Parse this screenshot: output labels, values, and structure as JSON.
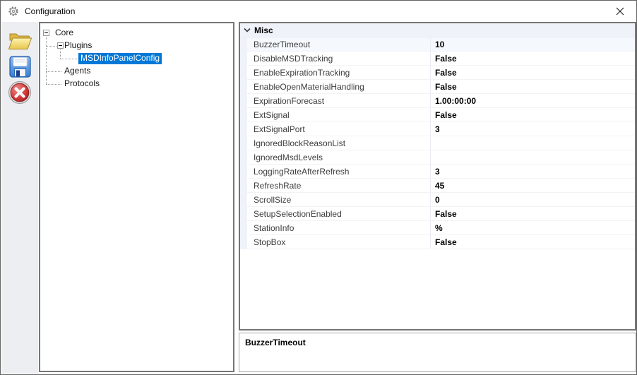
{
  "window": {
    "title": "Configuration"
  },
  "titlebar": {
    "close_glyph": "✕"
  },
  "toolbar": {
    "buttons": [
      {
        "name": "open",
        "icon": "open-folder-icon"
      },
      {
        "name": "save",
        "icon": "save-floppy-icon"
      },
      {
        "name": "cancel",
        "icon": "cancel-red-x-icon"
      }
    ]
  },
  "tree": {
    "nodes": [
      {
        "label": "Core",
        "level": 0,
        "has_children": true,
        "expanded": true
      },
      {
        "label": "Plugins",
        "level": 1,
        "has_children": true,
        "expanded": true
      },
      {
        "label": "MSDInfoPanelConfig",
        "level": 2,
        "selected": true
      },
      {
        "label": "Agents",
        "level": 1
      },
      {
        "label": "Protocols",
        "level": 1
      }
    ]
  },
  "property_grid": {
    "category": {
      "label": "Misc",
      "expanded": true
    },
    "rows": [
      {
        "name": "BuzzerTimeout",
        "value": "10",
        "selected": true
      },
      {
        "name": "DisableMSDTracking",
        "value": "False"
      },
      {
        "name": "EnableExpirationTracking",
        "value": "False"
      },
      {
        "name": "EnableOpenMaterialHandling",
        "value": "False"
      },
      {
        "name": "ExpirationForecast",
        "value": "1.00:00:00"
      },
      {
        "name": "ExtSignal",
        "value": "False"
      },
      {
        "name": "ExtSignalPort",
        "value": "3"
      },
      {
        "name": "IgnoredBlockReasonList",
        "value": ""
      },
      {
        "name": "IgnoredMsdLevels",
        "value": ""
      },
      {
        "name": "LoggingRateAfterRefresh",
        "value": "3"
      },
      {
        "name": "RefreshRate",
        "value": "45"
      },
      {
        "name": "ScrollSize",
        "value": "0"
      },
      {
        "name": "SetupSelectionEnabled",
        "value": "False"
      },
      {
        "name": "StationInfo",
        "value": "%"
      },
      {
        "name": "StopBox",
        "value": "False"
      }
    ]
  },
  "description_panel": {
    "selected_property": "BuzzerTimeout"
  },
  "colors": {
    "selection": "#0078d7",
    "category_row_bg": "#eff3f9"
  }
}
